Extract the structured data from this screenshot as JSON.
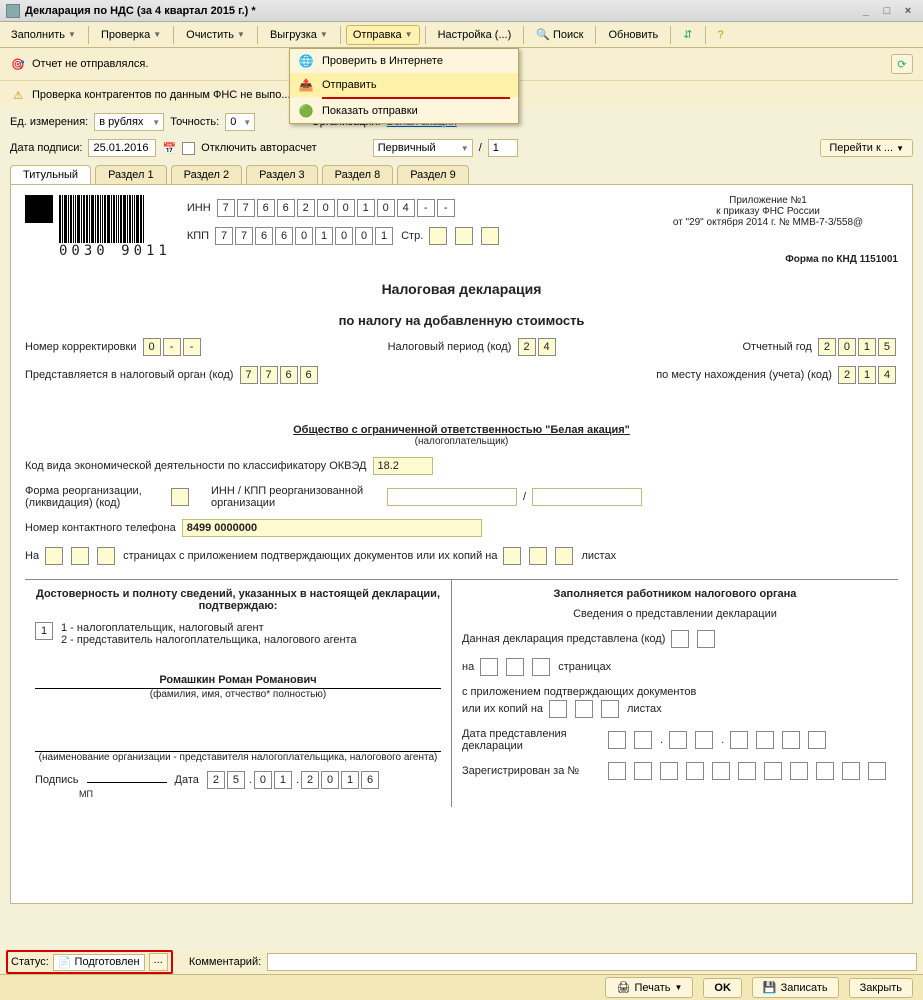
{
  "window": {
    "title": "Декларация по НДС (за 4 квартал 2015 г.) *"
  },
  "toolbar": {
    "fill": "Заполнить",
    "check": "Проверка",
    "clear": "Очистить",
    "export": "Выгрузка",
    "send": "Отправка",
    "settings": "Настройка (...)",
    "search": "Поиск",
    "refresh": "Обновить"
  },
  "send_menu": {
    "check_online": "Проверить в Интернете",
    "send": "Отправить",
    "show_sends": "Показать отправки"
  },
  "info": {
    "not_sent": "Отчет не отправлялся.",
    "counterparty_check": "Проверка контрагентов по данным ФНС не выпо..."
  },
  "params": {
    "measure_label": "Ед. измерения:",
    "measure": "в рублях",
    "precision_label": "Точность:",
    "precision": "0",
    "org_label": "Организация:",
    "org": "Белая акация",
    "sign_date_label": "Дата подписи:",
    "sign_date": "25.01.2016",
    "disable_calc": "Отключить авторасчет",
    "type": "Первичный",
    "slash": "/",
    "num": "1",
    "goto": "Перейти к ..."
  },
  "tabs": [
    "Титульный",
    "Раздел 1",
    "Раздел 2",
    "Раздел 3",
    "Раздел 8",
    "Раздел 9"
  ],
  "doc": {
    "barcode_text": "0030 9011",
    "inn_label": "ИНН",
    "inn": [
      "7",
      "7",
      "6",
      "6",
      "2",
      "0",
      "0",
      "1",
      "0",
      "4",
      "-",
      "-"
    ],
    "kpp_label": "КПП",
    "kpp": [
      "7",
      "7",
      "6",
      "6",
      "0",
      "1",
      "0",
      "0",
      "1"
    ],
    "page_label": "Стр.",
    "appendix": "Приложение №1",
    "appendix2": "к приказу ФНС России",
    "appendix3": "от \"29\" октября 2014 г. № ММВ-7-3/558@",
    "knd": "Форма по КНД 1151001",
    "title1": "Налоговая декларация",
    "title2": "по налогу на добавленную стоимость",
    "corr_label": "Номер корректировки",
    "corr": [
      "0",
      "-",
      "-"
    ],
    "period_label": "Налоговый период  (код)",
    "period": [
      "2",
      "4"
    ],
    "year_label": "Отчетный год",
    "year": [
      "2",
      "0",
      "1",
      "5"
    ],
    "tax_org_label": "Представляется в налоговый орган  (код)",
    "tax_org": [
      "7",
      "7",
      "6",
      "6"
    ],
    "place_label": "по месту нахождения (учета) (код)",
    "place": [
      "2",
      "1",
      "4"
    ],
    "payer_name": "Общество с ограниченной ответственностью \"Белая акация\"",
    "payer_sub": "(налогоплательщик)",
    "okved_label": "Код вида экономической деятельности по классификатору ОКВЭД",
    "okved": "18.2",
    "reorg_label": "Форма реорганизации, (ликвидация) (код)",
    "reorg_inn_label": "ИНН / КПП реорганизованной организации",
    "phone_label": "Номер контактного телефона",
    "phone": "8499 0000000",
    "pages_on": "На",
    "pages_mid": "страницах с приложением подтверждающих документов или их копий на",
    "pages_end": "листах",
    "left_col_title": "Достоверность и полноту сведений, указанных в настоящей декларации, подтверждаю:",
    "sign_type": "1",
    "sign_opt1": "1 - налогоплательщик, налоговый агент",
    "sign_opt2": "2 - представитель налогоплательщика, налогового агента",
    "fio": "Ромашкин Роман Романович",
    "fio_sub": "(фамилия, имя, отчество* полностью)",
    "org_repr_sub": "(наименование организации - представителя налогоплательщика, налогового агента)",
    "sig": "Подпись",
    "mp": "МП",
    "date_lbl": "Дата",
    "date": [
      "2",
      "5",
      ".",
      "0",
      "1",
      ".",
      "2",
      "0",
      "1",
      "6"
    ],
    "right_col_title": "Заполняется работником налогового органа",
    "right_sub": "Сведения о представлении декларации",
    "r1": "Данная декларация представлена  (код)",
    "r2": "на",
    "r2b": "страницах",
    "r3": "с приложением подтверждающих документов",
    "r3b": "или их копий на",
    "r3c": "листах",
    "r4": "Дата представления декларации",
    "r5": "Зарегистрирован за №"
  },
  "status": {
    "label": "Статус:",
    "value": "Подготовлен",
    "comment": "Комментарий:"
  },
  "footer": {
    "print": "Печать",
    "ok": "OK",
    "save": "Записать",
    "close": "Закрыть"
  }
}
